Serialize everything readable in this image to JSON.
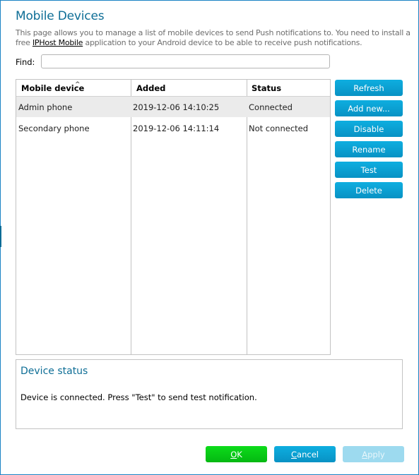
{
  "page": {
    "title": "Mobile Devices",
    "description_prefix": "This page allows you to manage a list of mobile devices to send Push notifications to. You need to install a free ",
    "description_link": "IPHost Mobile",
    "description_suffix": " application to your Android device to be able to receive push notifications."
  },
  "find": {
    "label": "Find:",
    "value": "",
    "placeholder": ""
  },
  "table": {
    "columns": [
      "Mobile device",
      "Added",
      "Status"
    ],
    "sort_indicator": "^",
    "rows": [
      {
        "device": "Admin phone",
        "added": "2019-12-06 14:10:25",
        "status": "Connected",
        "selected": true
      },
      {
        "device": "Secondary phone",
        "added": "2019-12-06 14:11:14",
        "status": "Not connected",
        "selected": false
      }
    ]
  },
  "side_buttons": {
    "refresh": "Refresh",
    "add_new": "Add new...",
    "disable": "Disable",
    "rename": "Rename",
    "test": "Test",
    "delete": "Delete"
  },
  "device_status": {
    "title": "Device status",
    "message": "Device is connected. Press \"Test\" to send test notification."
  },
  "footer": {
    "ok_mnemonic": "O",
    "ok_rest": "K",
    "cancel_mnemonic": "C",
    "cancel_rest": "ancel",
    "apply_mnemonic": "A",
    "apply_rest": "pply",
    "apply_enabled": false
  },
  "colors": {
    "accent": "#0e6e96",
    "button_blue": "#0892c4",
    "button_green": "#04b812",
    "button_disabled": "#9ddaef"
  }
}
